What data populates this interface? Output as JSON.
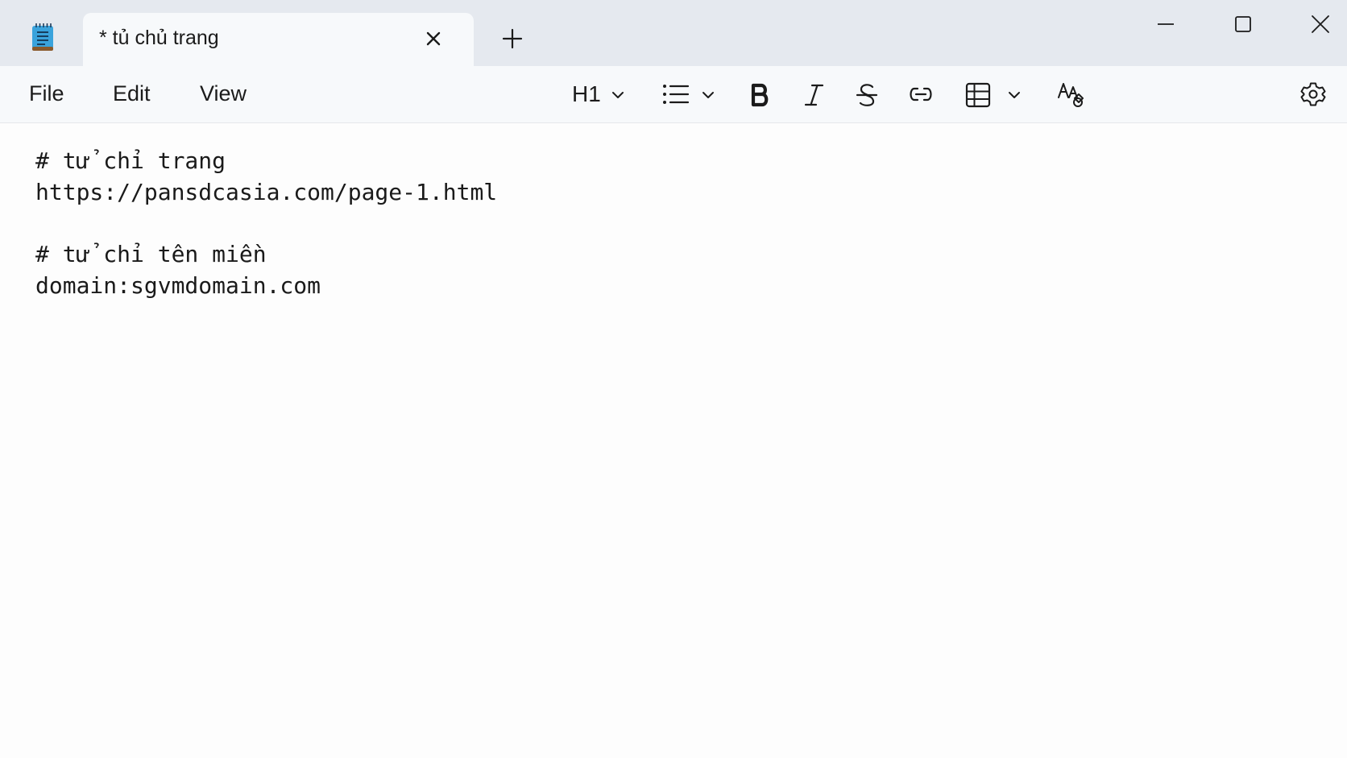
{
  "tab": {
    "title": "* tủ chủ trang"
  },
  "menu": {
    "file": "File",
    "edit": "Edit",
    "view": "View"
  },
  "toolbar": {
    "heading_level": "H1",
    "icons": [
      "list-icon",
      "bold-icon",
      "italic-icon",
      "strikethrough-icon",
      "link-icon",
      "table-icon",
      "clear-formatting-icon",
      "settings-icon"
    ]
  },
  "document": {
    "lines": [
      "# tử chỉ trang",
      "https://pansdcasia.com/page-1.html",
      "",
      "# tử chỉ tên miền",
      "domain:sgvmdomain.com"
    ]
  },
  "colors": {
    "titlebar": "#e5e9ef",
    "toolbar": "#f7f9fb",
    "editor": "#fdfdfd",
    "app_icon": "#3aa3dc"
  }
}
